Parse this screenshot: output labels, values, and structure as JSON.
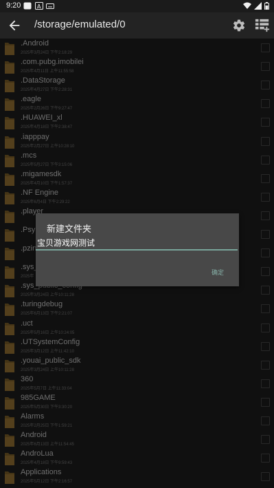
{
  "status_bar": {
    "time": "9:20"
  },
  "app_bar": {
    "path": "/storage/emulated/0"
  },
  "files": [
    {
      "name": ".Android",
      "date": "2025年3月24日 下午2:18:29"
    },
    {
      "name": ".com.pubg.imobilei",
      "date": "2025年4月11日 上午11:55:58"
    },
    {
      "name": ".DataStorage",
      "date": "2025年4月27日 下午2:28:31"
    },
    {
      "name": ".eagle",
      "date": "2025年2月26日 下午9:27:47"
    },
    {
      "name": ".HUAWEI_xl",
      "date": "2025年4月18日 下午2:38:47"
    },
    {
      "name": ".iapppay",
      "date": "2025年2月27日 上午10:28:10"
    },
    {
      "name": ".mcs",
      "date": "2025年5月27日 下午3:15:06"
    },
    {
      "name": ".migamesdk",
      "date": "2025年4月10日 下午1:57:37"
    },
    {
      "name": ".NF Engine",
      "date": "2025年6月4日 下午2:29:22"
    },
    {
      "name": ".player",
      "date": ""
    },
    {
      "name": ".Psy",
      "date": ""
    },
    {
      "name": ".pzin",
      "date": ""
    },
    {
      "name": ".sys_",
      "date": "2025年"
    },
    {
      "name": ".sys_public_config",
      "date": "2025年3月24日 上午10:11:28"
    },
    {
      "name": ".turingdebug",
      "date": "2025年6月13日 下午2:21:07"
    },
    {
      "name": ".uct",
      "date": "2025年5月16日 上午10:24:05"
    },
    {
      "name": ".UTSystemConfig",
      "date": "2025年3月12日 上午11:42:10"
    },
    {
      "name": ".youai_public_sdk",
      "date": "2025年3月24日 上午10:11:28"
    },
    {
      "name": "360",
      "date": "2025年5月7日 上午11:33:04"
    },
    {
      "name": "985GAME",
      "date": "2025年5月30日 下午3:30:20"
    },
    {
      "name": "Alarms",
      "date": "2025年2月25日 下午1:59:21"
    },
    {
      "name": "Android",
      "date": "2025年6月13日 上午11:54:45"
    },
    {
      "name": "AndroLua",
      "date": "2025年4月18日 下午9:59:43"
    },
    {
      "name": "Applications",
      "date": "2025年5月12日 下午2:16:57"
    }
  ],
  "dialog": {
    "title": "新建文件夹",
    "input_value": "宝贝游戏网测试",
    "ok_label": "确定"
  },
  "colors": {
    "accent": "#78a59a",
    "folder": "#8b6a2f",
    "background": "#1e1e1e"
  }
}
